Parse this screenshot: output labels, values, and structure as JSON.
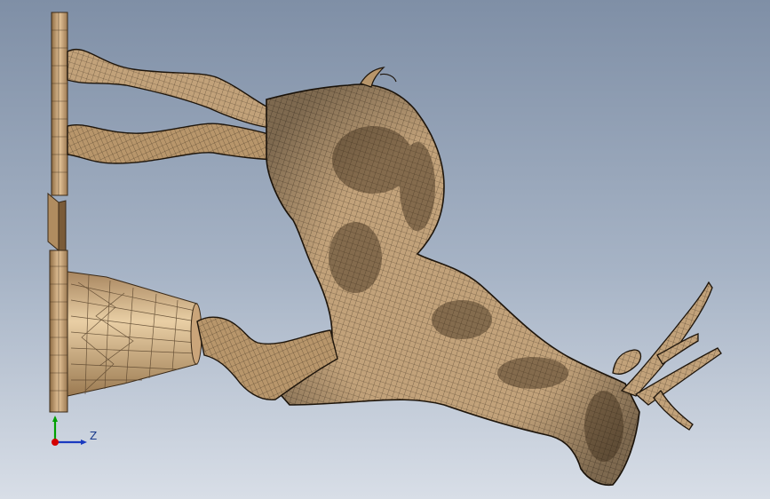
{
  "viewport": {
    "background_top": "#7f8fa6",
    "background_bottom": "#d8dee7"
  },
  "model": {
    "mesh_fill": "#c2a27a",
    "mesh_shadow": "#5a452d",
    "mesh_line": "#2a1f12",
    "base_fill": "#d9b88c"
  },
  "triad": {
    "z_label": "Z",
    "x_color": "#d40000",
    "y_color": "#00a000",
    "z_color": "#1a3ac0"
  }
}
